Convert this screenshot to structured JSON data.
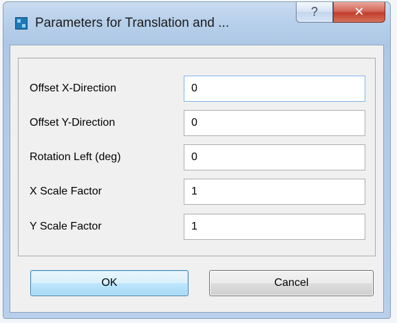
{
  "window": {
    "title": "Parameters for Translation and ...",
    "help_glyph": "?",
    "close_glyph": "✕",
    "app_icon": "grid-app-icon"
  },
  "fields": [
    {
      "label": "Offset X-Direction",
      "value": "0"
    },
    {
      "label": "Offset Y-Direction",
      "value": "0"
    },
    {
      "label": "Rotation Left (deg)",
      "value": "0"
    },
    {
      "label": "X Scale Factor",
      "value": "1"
    },
    {
      "label": "Y Scale Factor",
      "value": "1"
    }
  ],
  "buttons": {
    "ok_label": "OK",
    "cancel_label": "Cancel"
  },
  "colors": {
    "close_button": "#c8483a",
    "ok_button_border": "#3c7fb1",
    "window_frame": "#b7cfea"
  }
}
